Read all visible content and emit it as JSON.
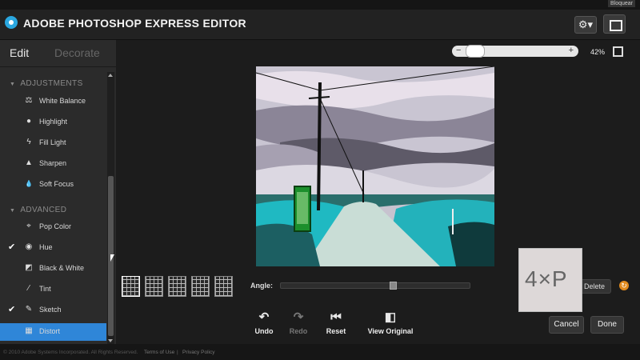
{
  "header": {
    "title": "ADOBE PHOTOSHOP EXPRESS EDITOR",
    "top_right_link": "Bloquear",
    "gear_menu_glyph": "⚙▾"
  },
  "sidebar": {
    "tabs": {
      "edit": "Edit",
      "decorate": "Decorate"
    },
    "sections": [
      {
        "title": "ADJUSTMENTS",
        "items": [
          {
            "label": "White Balance",
            "icon": "scale-icon",
            "glyph": "⚖",
            "checked": false
          },
          {
            "label": "Highlight",
            "icon": "bulb-icon",
            "glyph": "●",
            "checked": false
          },
          {
            "label": "Fill Light",
            "icon": "lightning-icon",
            "glyph": "ϟ",
            "checked": false
          },
          {
            "label": "Sharpen",
            "icon": "triangle-icon",
            "glyph": "▲",
            "checked": false
          },
          {
            "label": "Soft Focus",
            "icon": "drop-icon",
            "glyph": "💧",
            "checked": false
          }
        ]
      },
      {
        "title": "ADVANCED",
        "items": [
          {
            "label": "Pop Color",
            "icon": "crosshair-icon",
            "glyph": "⌖",
            "checked": false
          },
          {
            "label": "Hue",
            "icon": "palette-icon",
            "glyph": "◉",
            "checked": true
          },
          {
            "label": "Black & White",
            "icon": "half-square-icon",
            "glyph": "◩",
            "checked": false
          },
          {
            "label": "Tint",
            "icon": "pipette-icon",
            "glyph": "⁄",
            "checked": false
          },
          {
            "label": "Sketch",
            "icon": "pencil-icon",
            "glyph": "✎",
            "checked": true
          },
          {
            "label": "Distort",
            "icon": "grid-icon",
            "glyph": "▦",
            "checked": false,
            "selected": true
          }
        ]
      }
    ],
    "check_glyph": "✔"
  },
  "canvas": {
    "zoom_minus": "−",
    "zoom_plus": "+",
    "zoom_level": "42%",
    "zoom_fraction": 0.05
  },
  "controls": {
    "angle_label": "Angle:",
    "angle_fraction": 0.6,
    "delete_label": "Delete",
    "revert_glyph": "↻"
  },
  "watermark": {
    "text": "4×P"
  },
  "actions": {
    "undo": {
      "label": "Undo",
      "glyph": "↶"
    },
    "redo": {
      "label": "Redo",
      "glyph": "↷"
    },
    "reset": {
      "label": "Reset",
      "glyph": "⏮"
    },
    "view_original": {
      "label": "View Original",
      "glyph": "◧"
    },
    "cancel": "Cancel",
    "done": "Done"
  },
  "footer": {
    "copyright": "© 2010 Adobe Systems Incorporated. All Rights Reserved.",
    "terms": "Terms of Use",
    "separator": "|",
    "privacy": "Privacy Policy"
  },
  "colors": {
    "accent_selected": "#2f86d8",
    "revert_orange": "#e08a1e",
    "logo_blue": "#2aa7e0"
  }
}
